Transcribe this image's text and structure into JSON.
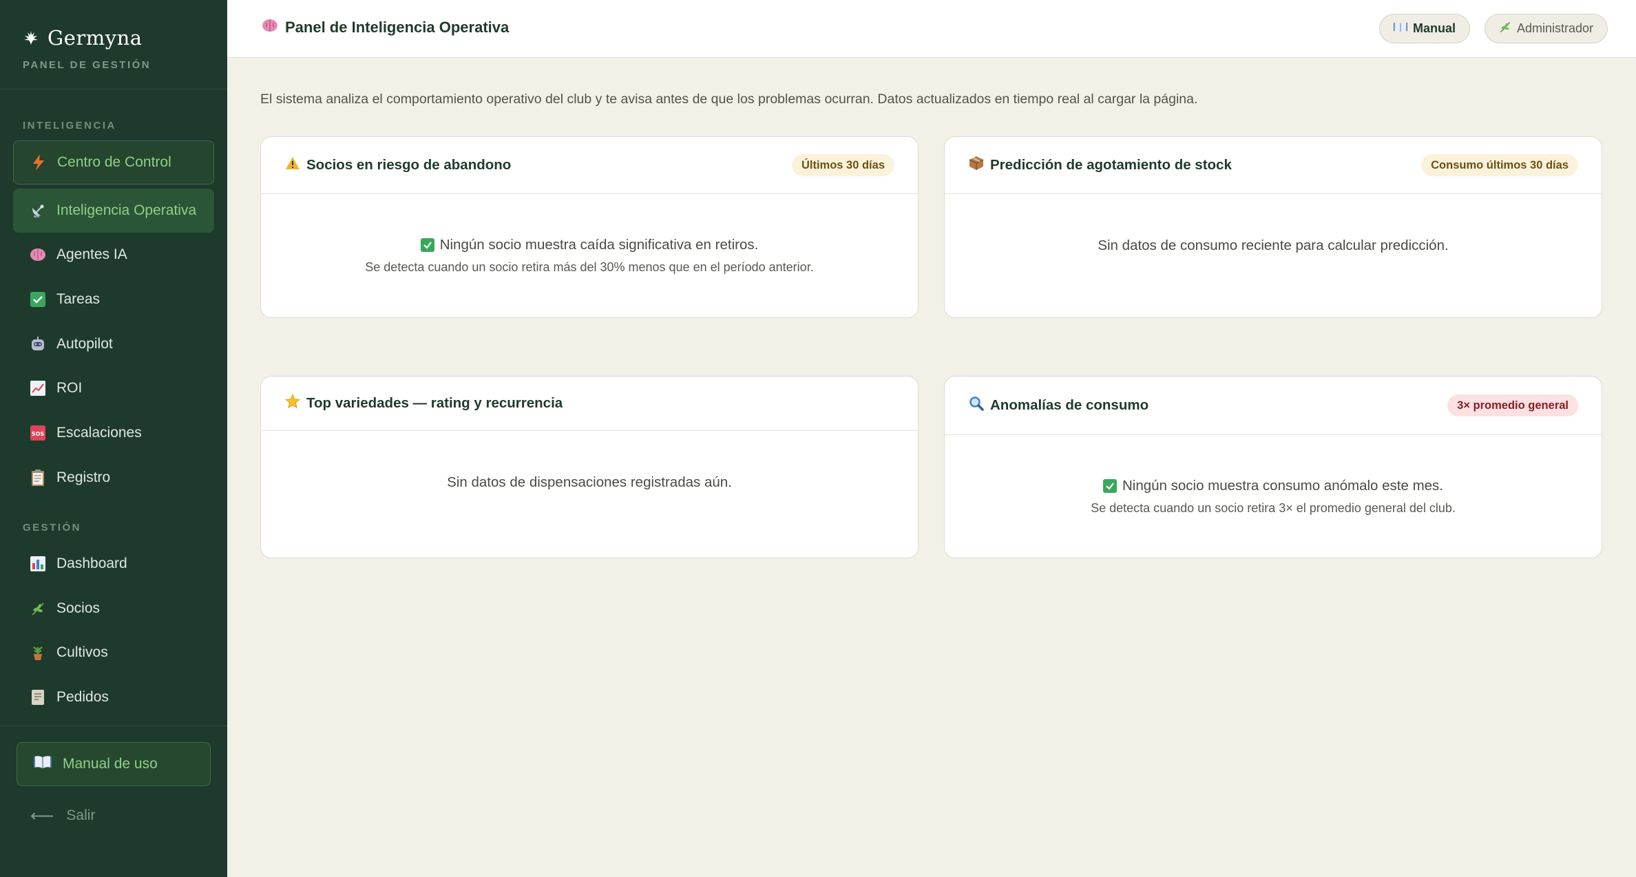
{
  "brand": {
    "name": "Germyna",
    "subtitle": "PANEL DE GESTIÓN"
  },
  "sidebar": {
    "section_intel": "INTELIGENCIA",
    "section_gestion": "GESTIÓN",
    "items": [
      {
        "label": "Centro de Control",
        "icon": "lightning-icon"
      },
      {
        "label": "Inteligencia Operativa",
        "icon": "satellite-dish-icon"
      },
      {
        "label": "Agentes IA",
        "icon": "brain-icon"
      },
      {
        "label": "Tareas",
        "icon": "check-box-icon"
      },
      {
        "label": "Autopilot",
        "icon": "robot-icon"
      },
      {
        "label": "ROI",
        "icon": "chart-up-icon"
      },
      {
        "label": "Escalaciones",
        "icon": "sos-icon"
      },
      {
        "label": "Registro",
        "icon": "clipboard-icon"
      },
      {
        "label": "Dashboard",
        "icon": "bar-chart-icon"
      },
      {
        "label": "Socios",
        "icon": "herb-icon"
      },
      {
        "label": "Cultivos",
        "icon": "potted-plant-icon"
      },
      {
        "label": "Pedidos",
        "icon": "receipt-icon"
      }
    ],
    "manual_label": "Manual de uso",
    "logout_label": "Salir",
    "logout_arrow": "⟵"
  },
  "header": {
    "title": "Panel de Inteligencia Operativa",
    "manual_button": "Manual",
    "user_button": "Administrador"
  },
  "intro": "El sistema analiza el comportamiento operativo del club y te avisa antes de que los problemas ocurran. Datos actualizados en tiempo real al cargar la página.",
  "cards": {
    "churn": {
      "title": "Socios en riesgo de abandono",
      "badge": "Últimos 30 días",
      "message": "Ningún socio muestra caída significativa en retiros.",
      "detail": "Se detecta cuando un socio retira más del 30% menos que en el período anterior."
    },
    "stock": {
      "title": "Predicción de agotamiento de stock",
      "badge": "Consumo últimos 30 días",
      "message": "Sin datos de consumo reciente para calcular predicción."
    },
    "top": {
      "title": "Top variedades — rating y recurrencia",
      "message": "Sin datos de dispensaciones registradas aún."
    },
    "anomalies": {
      "title": "Anomalías de consumo",
      "badge": "3× promedio general",
      "message": "Ningún socio muestra consumo anómalo este mes.",
      "detail": "Se detecta cuando un socio retira 3× el promedio general del club."
    }
  },
  "colors": {
    "sidebar_bg": "#1e3a2c",
    "accent_green": "#8fcf86",
    "page_bg": "#f3f0e8",
    "badge_warm": "#fbf2dc",
    "badge_red": "#fbe1e1"
  }
}
